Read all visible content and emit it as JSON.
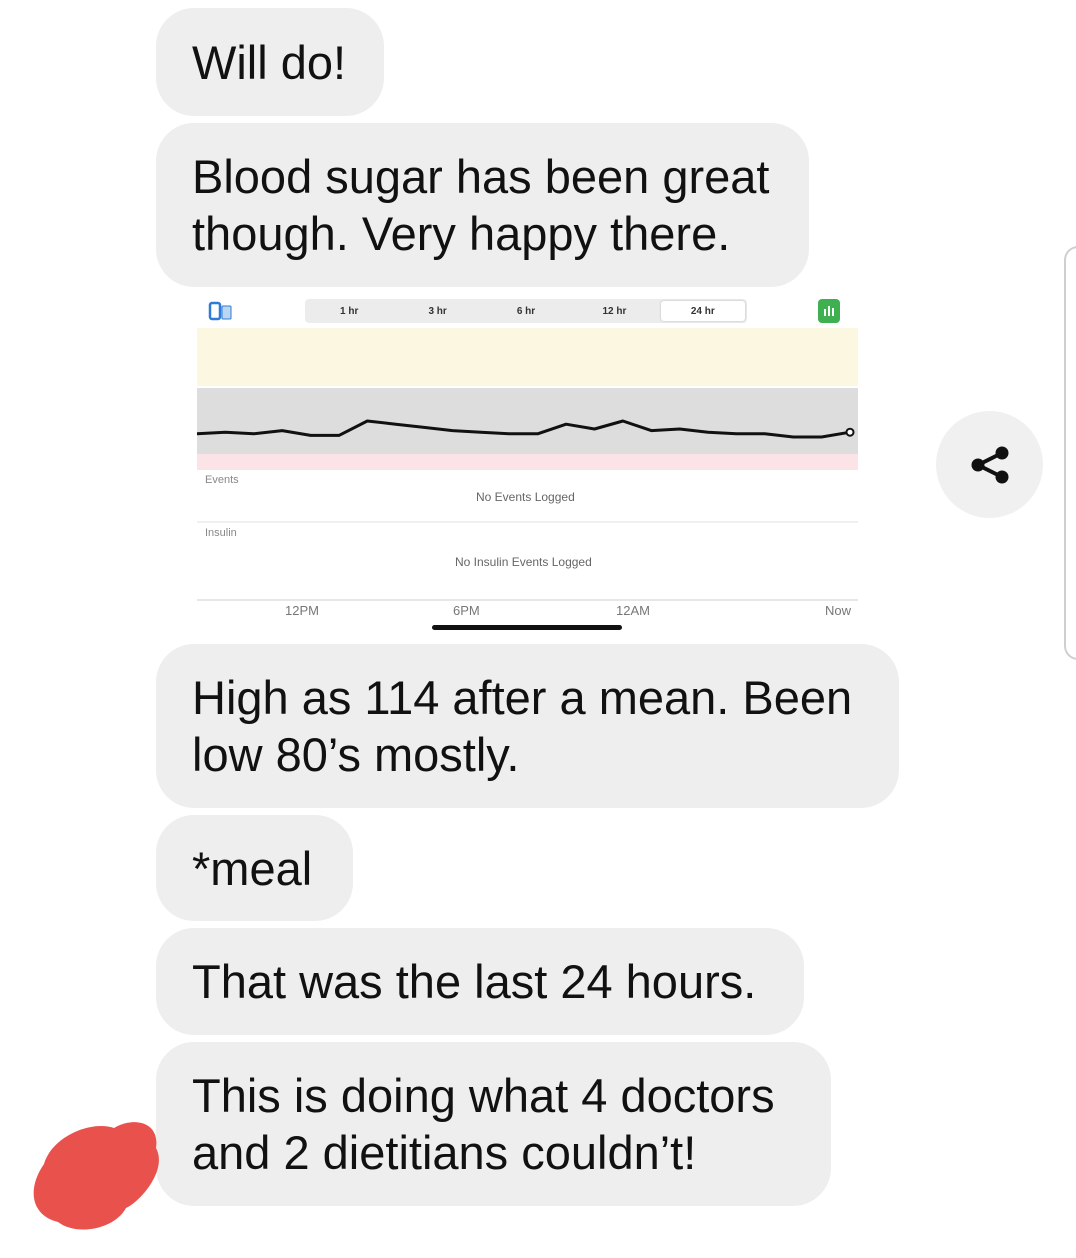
{
  "messages": [
    {
      "id": "msg1",
      "text": "Will do!"
    },
    {
      "id": "msg2",
      "lines": [
        "Blood sugar has been great",
        "though. Very happy there."
      ]
    },
    {
      "id": "msg3",
      "lines": [
        "High as 114 after a mean. Been",
        "low 80’s mostly."
      ]
    },
    {
      "id": "msg4",
      "text": "*meal"
    },
    {
      "id": "msg5",
      "text": "That was the last 24 hours."
    },
    {
      "id": "msg6",
      "lines": [
        "This is doing what 4 doctors",
        "and 2 dietitians couldn’t!"
      ]
    }
  ],
  "attachment": {
    "range_tabs": [
      "1 hr",
      "3 hr",
      "6 hr",
      "12 hr",
      "24 hr"
    ],
    "active_tab": "24 hr",
    "events_label": "Events",
    "events_empty": "No Events Logged",
    "insulin_label": "Insulin",
    "insulin_empty": "No Insulin Events Logged",
    "time_labels": [
      "12PM",
      "6PM",
      "12AM",
      "Now"
    ],
    "colors": {
      "high_zone": "#fbf7e1",
      "target_zone": "#dddddd",
      "low_zone": "#fbe3e8",
      "trace": "#111111",
      "accent": "#3fb04f"
    }
  },
  "chart_data": {
    "type": "line",
    "title": "",
    "xlabel": "",
    "ylabel": "",
    "x_ticks": [
      "12PM",
      "6PM",
      "12AM",
      "Now"
    ],
    "series": [
      {
        "values": [
          82,
          83,
          82,
          84,
          81,
          81,
          90,
          88,
          86,
          84,
          83,
          82,
          82,
          88,
          85,
          90,
          84,
          85,
          83,
          82,
          82,
          80,
          80,
          83
        ]
      }
    ]
  },
  "icons": {
    "share": "share-icon",
    "device": "phone-device-icon",
    "graph_toggle": "bar-graph-icon"
  }
}
